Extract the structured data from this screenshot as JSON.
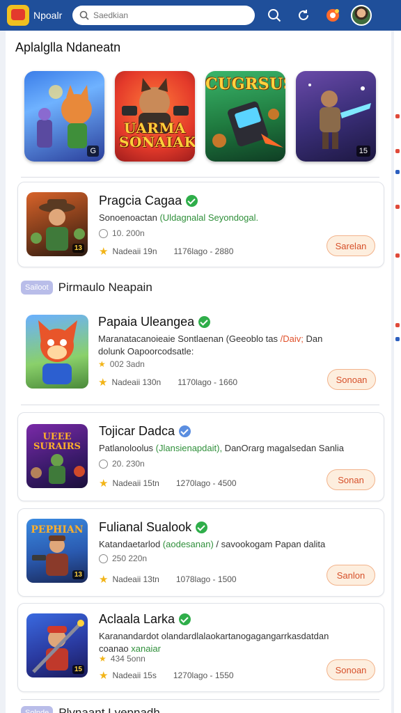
{
  "header": {
    "logo_text": "Npoalr",
    "search_placeholder": "Saedkian",
    "icons": [
      "search-icon",
      "refresh-icon",
      "notification-icon",
      "avatar"
    ]
  },
  "section": {
    "title": "Aplalglla Ndaneatn"
  },
  "featured": [
    {
      "name": "hero-cat",
      "badge": "G",
      "text": ""
    },
    {
      "name": "jarma-sonaiakn",
      "badge": "",
      "text": "UARMA SONAIAKN"
    },
    {
      "name": "cugrsus",
      "badge": "",
      "text": "CUGRSUS"
    },
    {
      "name": "space-hero",
      "badge": "15",
      "text": ""
    }
  ],
  "cards_top": [
    {
      "title": "Pragcia Cagaa",
      "verified_color": "#2fae4a",
      "desc_pre": "Sonoenoactan ",
      "desc_hl": "(Uldagnalal Seyondogal.",
      "desc_post": "",
      "meta": "10. 200n",
      "rating": "Nadeaii 19n",
      "downloads": "1176lago - 2880",
      "button": "Sarelan",
      "thumb_badge": "13"
    }
  ],
  "sub_header_1": {
    "pill": "Sailoot",
    "label": "Pirmaulo Neapain"
  },
  "cards": [
    {
      "title": "Papaia Uleangea",
      "verified_color": "#2fae4a",
      "desc_pre": "Maranatacanoieaie Sontlaenan (Geeoblo tas ",
      "desc_hl": "/Daiv;",
      "desc_post": " Dan dolunk Oapoorcodsatle:",
      "meta": "002 3adn",
      "rating": "Nadeaii 130n",
      "downloads": "1170lago - 1660",
      "button": "Sonoan",
      "thumb_badge": ""
    },
    {
      "title": "Tojicar Dadca",
      "verified_color": "#5b8ee0",
      "desc_pre": "Patlanoloolus ",
      "desc_hl": "(Jlansienapdait),",
      "desc_post": " DanOrarg magalsedan Sanlia",
      "meta": "20. 230n",
      "rating": "Nadeaii 15tn",
      "downloads": "1270lago - 4500",
      "button": "Sonan",
      "thumb_badge": ""
    },
    {
      "title": "Fulianal Sualook",
      "verified_color": "#2fae4a",
      "desc_pre": "Katandaetarlod ",
      "desc_hl": "(aodesanan)",
      "desc_post": " / savookogam Papan dalita",
      "meta": "250 220n",
      "rating": "Nadeaii 13tn",
      "downloads": "1078lago - 1500",
      "button": "Sanlon",
      "thumb_badge": "13"
    },
    {
      "title": "Aclaala Larka",
      "verified_color": "#2fae4a",
      "desc_pre": "Karanandardot olandardlalaokartanogagangarrkasdatdan coanao ",
      "desc_hl": "xanaiar",
      "desc_post": "",
      "meta": "434 5onn",
      "rating": "Nadeaii 15s",
      "downloads": "1270lago - 1550",
      "button": "Sonoan",
      "thumb_badge": "15"
    }
  ],
  "sub_header_2": {
    "pill": "Solnde",
    "label": "Plynaant Lvepnadh"
  }
}
